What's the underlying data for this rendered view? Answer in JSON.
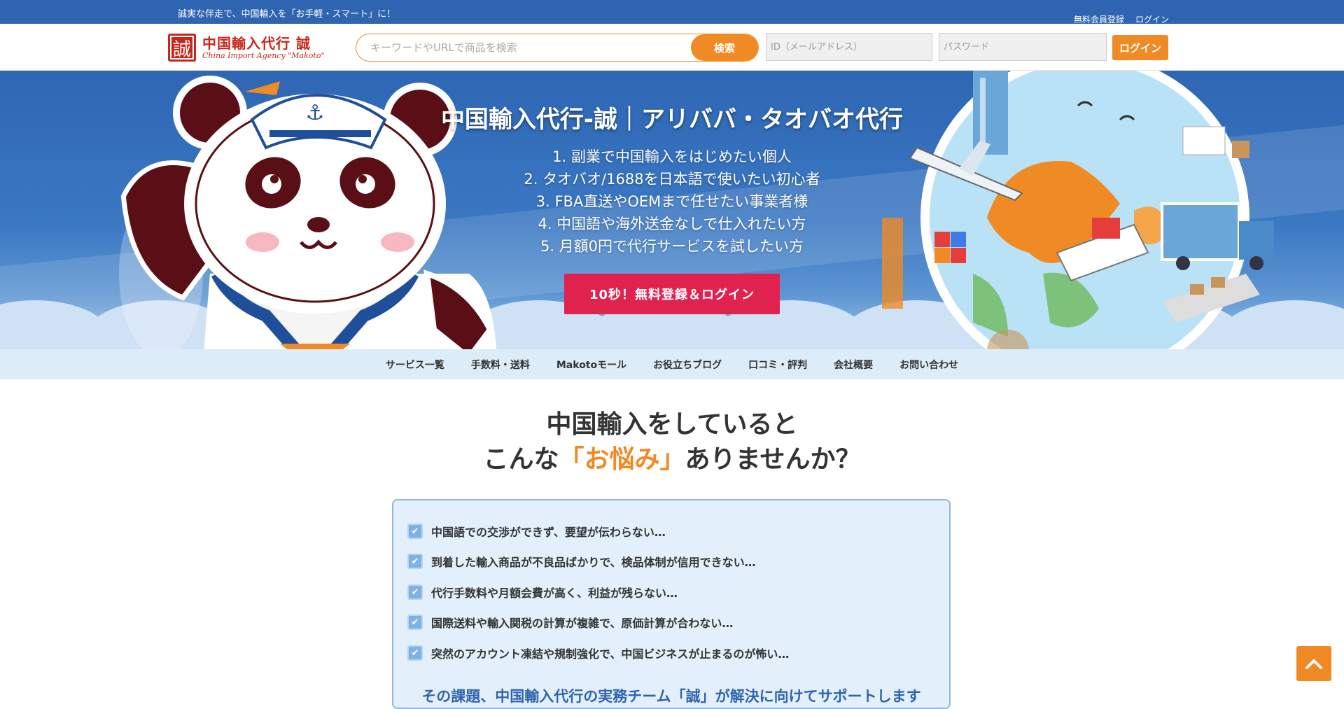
{
  "topbar": {
    "tagline": "誠実な伴走で、中国輸入を「お手軽・スマート」に！",
    "register_link": "無料会員登録",
    "login_link": "ログイン"
  },
  "header": {
    "logo_seal": "誠",
    "logo_name": "中国輸入代行 誠",
    "logo_sub": "China Import Agency \"Makoto\"",
    "search_placeholder": "キーワードやURLで商品を検索",
    "search_button": "検索",
    "id_placeholder": "ID（メールアドレス）",
    "password_placeholder": "パスワード",
    "login_button": "ログイン"
  },
  "hero": {
    "title": "中国輸入代行-誠｜アリババ・タオバオ代行",
    "list": [
      "1. 副業で中国輸入をはじめたい個人",
      "2. タオバオ/1688を日本語で使いたい初心者",
      "3. FBA直送やOEMまで任せたい事業者様",
      "4. 中国語や海外送金なしで仕入れたい方",
      "5. 月額0円で代行サービスを試したい方"
    ],
    "cta": "10秒！無料登録＆ログイン"
  },
  "nav": [
    "サービス一覧",
    "手数料・送料",
    "Makotoモール",
    "お役立ちブログ",
    "口コミ・評判",
    "会社概要",
    "お問い合わせ"
  ],
  "concern": {
    "line1": "中国輸入をしていると",
    "line2_pre": "こんな",
    "line2_highlight": "「お悩み」",
    "line2_post": "ありませんか？"
  },
  "problems": [
    "中国語での交渉ができず、要望が伝わらない…",
    "到着した輸入商品が不良品ばかりで、検品体制が信用できない…",
    "代行手数料や月額会費が高く、利益が残らない…",
    "国際送料や輸入関税の計算が複雑で、原価計算が合わない…",
    "突然のアカウント凍結や規制強化で、中国ビジネスが止まるのが怖い…"
  ],
  "problems_footer": "その課題、中国輸入代行の実務チーム「誠」が解決に向けてサポートします",
  "colors": {
    "primary_blue": "#2f64b0",
    "accent_orange": "#f08a24",
    "cta_red": "#e0224e",
    "box_bg": "#e3f0fb"
  },
  "icons": {
    "check": "check-icon",
    "back_to_top": "chevron-up-icon",
    "search": "search-icon"
  }
}
